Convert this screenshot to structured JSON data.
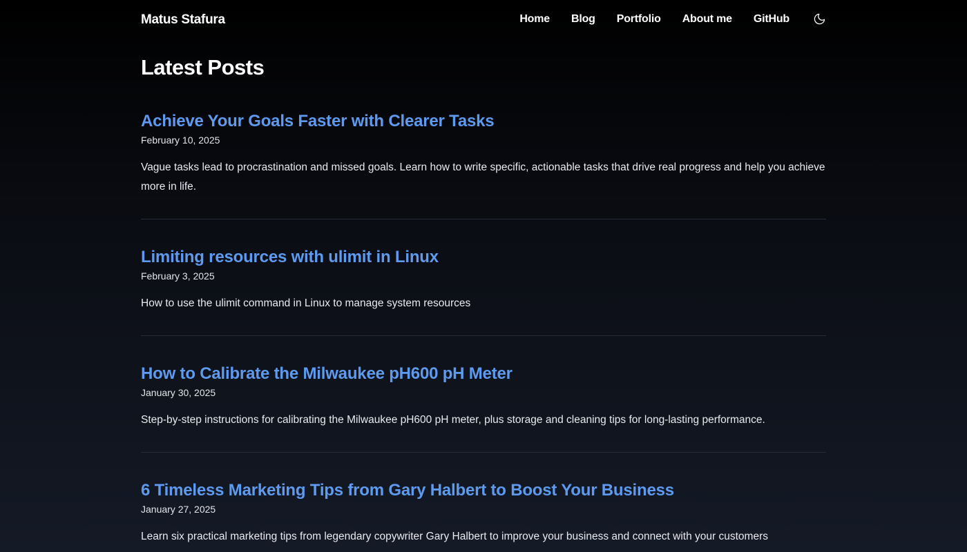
{
  "header": {
    "brand": "Matus Stafura",
    "nav": [
      "Home",
      "Blog",
      "Portfolio",
      "About me",
      "GitHub"
    ],
    "theme_toggle_icon": "moon-icon"
  },
  "main": {
    "title": "Latest Posts",
    "posts": [
      {
        "title": "Achieve Your Goals Faster with Clearer Tasks",
        "date": "February 10, 2025",
        "description": "Vague tasks lead to procrastination and missed goals. Learn how to write specific, actionable tasks that drive real progress and help you achieve more in life."
      },
      {
        "title": "Limiting resources with ulimit in Linux",
        "date": "February 3, 2025",
        "description": "How to use the ulimit command in Linux to manage system resources"
      },
      {
        "title": "How to Calibrate the Milwaukee pH600 pH Meter",
        "date": "January 30, 2025",
        "description": "Step-by-step instructions for calibrating the Milwaukee pH600 pH meter, plus storage and cleaning tips for long-lasting performance."
      },
      {
        "title": "6 Timeless Marketing Tips from Gary Halbert to Boost Your Business",
        "date": "January 27, 2025",
        "description": "Learn six practical marketing tips from legendary copywriter Gary Halbert to improve your business and connect with your customers"
      }
    ]
  },
  "colors": {
    "link": "#5e9bf0",
    "text": "#e8eaf0",
    "divider": "#262b36"
  }
}
